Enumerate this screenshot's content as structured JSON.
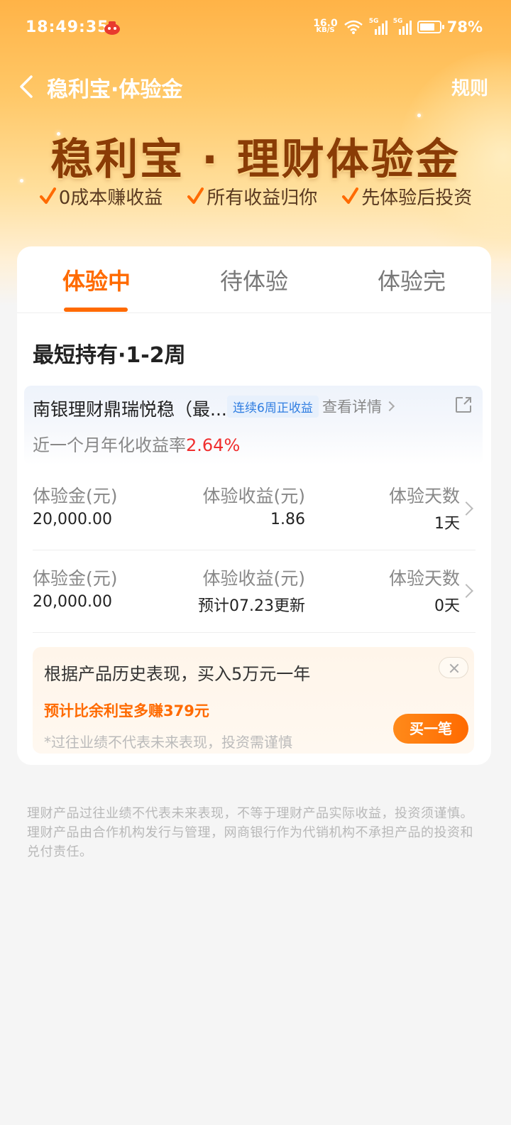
{
  "status_bar": {
    "time": "18:49:35",
    "net_speed_value": "16.0",
    "net_speed_unit": "KB/S",
    "signal1_label": "5G",
    "signal2_label": "5G",
    "battery": "78%",
    "battery_level": 0.78
  },
  "nav": {
    "title": "稳利宝·体验金",
    "rule_label": "规则"
  },
  "hero": {
    "title": "稳利宝 · 理财体验金",
    "features": [
      "0成本赚收益",
      "所有收益归你",
      "先体验后投资"
    ]
  },
  "tabs": [
    "体验中",
    "待体验",
    "体验完"
  ],
  "section_title": "最短持有·1-2周",
  "product": {
    "name": "南银理财鼎瑞悦稳（最...",
    "badge": "连续6周正收益",
    "detail_link": "查看详情",
    "rate_label": "近一个月年化收益率",
    "rate_value": "2.64%"
  },
  "rows": [
    {
      "col1_label": "体验金(元)",
      "col1_value": "20,000.00",
      "col2_label": "体验收益(元)",
      "col2_value": "1.86",
      "col3_label": "体验天数",
      "col3_value": "1天"
    },
    {
      "col1_label": "体验金(元)",
      "col1_value": "20,000.00",
      "col2_label": "体验收益(元)",
      "col2_value": "预计07.23更新",
      "col3_label": "体验天数",
      "col3_value": "0天"
    }
  ],
  "promo": {
    "text": "根据产品历史表现，买入5万元一年",
    "highlight": "预计比余利宝多赚379元",
    "note": "*过往业绩不代表未来表现，投资需谨慎",
    "buy_label": "买一笔"
  },
  "disclaimer": "理财产品过往业绩不代表未来表现，不等于理财产品实际收益，投资须谨慎。理财产品由合作机构发行与管理，网商银行作为代销机构不承担产品的投资和兑付责任。",
  "colors": {
    "accent": "#ff6a00",
    "rate": "#f02e2e",
    "hero_title": "#8a3c06",
    "badge": "#2f7de1"
  }
}
